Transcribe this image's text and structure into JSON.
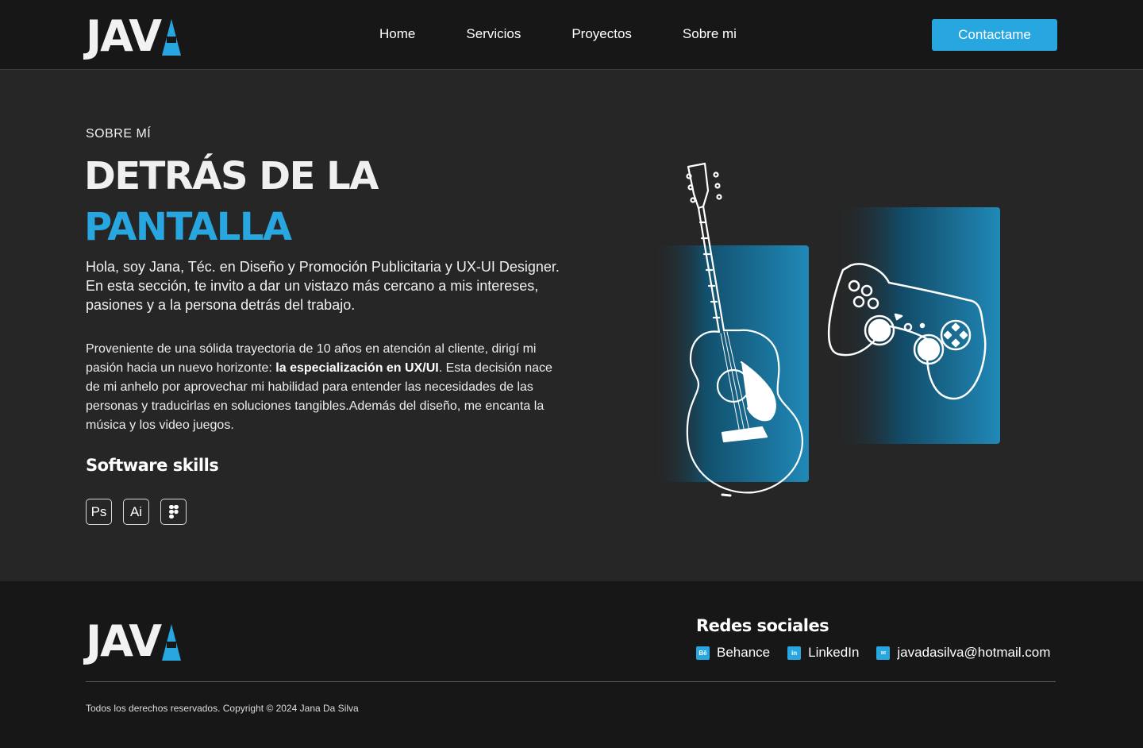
{
  "brand": {
    "logo_text": "JAV",
    "accent_color": "#27a6df"
  },
  "nav": {
    "items": [
      {
        "label": "Home"
      },
      {
        "label": "Servicios"
      },
      {
        "label": "Proyectos"
      },
      {
        "label": "Sobre mi"
      }
    ],
    "contact_label": "Contactame"
  },
  "about": {
    "eyebrow": "SOBRE MÍ",
    "title_line1": "DETRÁS DE LA",
    "title_line2": "PANTALLA",
    "intro": "Hola, soy Jana, Téc. en Diseño y Promoción Publicitaria y UX-UI Designer. En esta sección, te invito a dar un vistazo más cercano a mis intereses, pasiones y a la persona detrás del trabajo.",
    "body_before": "Proveniente de una sólida trayectoria de 10 años en atención al cliente, dirigí mi pasión hacia un nuevo horizonte: ",
    "body_bold": "la especialización en UX/UI",
    "body_after": ". Esta decisión nace de mi anhelo por aprovechar mi habilidad para entender las necesidades de las personas y traducirlas en soluciones tangibles.Además del diseño, me encanta la música y los video juegos.",
    "skills_title": "Software skills",
    "skills": [
      {
        "label": "Ps",
        "icon": "photoshop-icon"
      },
      {
        "label": "Ai",
        "icon": "illustrator-icon"
      },
      {
        "label": "",
        "icon": "figma-icon"
      }
    ]
  },
  "illustration": {
    "icons": [
      "guitar-icon",
      "gamepad-icon"
    ]
  },
  "footer": {
    "social_title": "Redes sociales",
    "socials": [
      {
        "label": "Behance",
        "icon": "behance-icon",
        "glyph": "Bē"
      },
      {
        "label": "LinkedIn",
        "icon": "linkedin-icon",
        "glyph": "in"
      },
      {
        "label": "javadasilva@hotmail.com",
        "icon": "mail-icon",
        "glyph": "✉"
      }
    ],
    "copyright": "Todos los derechos reservados. Copyright © 2024 Jana Da Silva"
  }
}
